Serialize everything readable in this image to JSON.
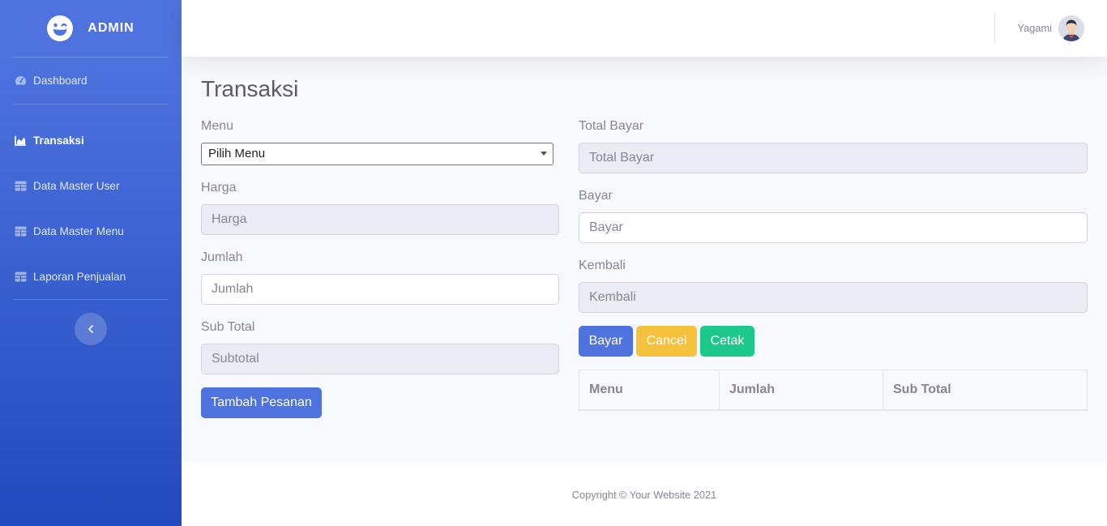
{
  "sidebar": {
    "brand": "ADMIN",
    "items": [
      {
        "label": "Dashboard",
        "icon": "tachometer-icon"
      },
      {
        "label": "Transaksi",
        "icon": "area-chart-icon",
        "active": true
      },
      {
        "label": "Data Master User",
        "icon": "table-icon"
      },
      {
        "label": "Data Master Menu",
        "icon": "table-icon"
      },
      {
        "label": "Laporan Penjualan",
        "icon": "table-icon"
      }
    ]
  },
  "topbar": {
    "user_name": "Yagami"
  },
  "page": {
    "title": "Transaksi",
    "left": {
      "menu_label": "Menu",
      "menu_selected": "Pilih Menu",
      "harga_label": "Harga",
      "harga_placeholder": "Harga",
      "jumlah_label": "Jumlah",
      "jumlah_placeholder": "Jumlah",
      "subtotal_label": "Sub Total",
      "subtotal_placeholder": "Subtotal",
      "add_button": "Tambah Pesanan"
    },
    "right": {
      "total_label": "Total Bayar",
      "total_placeholder": "Total Bayar",
      "bayar_label": "Bayar",
      "bayar_placeholder": "Bayar",
      "kembali_label": "Kembali",
      "kembali_placeholder": "Kembali",
      "buttons": {
        "bayar": "Bayar",
        "cancel": "Cancel",
        "cetak": "Cetak"
      },
      "table_headers": [
        "Menu",
        "Jumlah",
        "Sub Total"
      ]
    }
  },
  "footer": {
    "copyright": "Copyright © Your Website 2021"
  },
  "colors": {
    "primary": "#4e73df",
    "warning": "#f6c23e",
    "success": "#1cc88a"
  }
}
